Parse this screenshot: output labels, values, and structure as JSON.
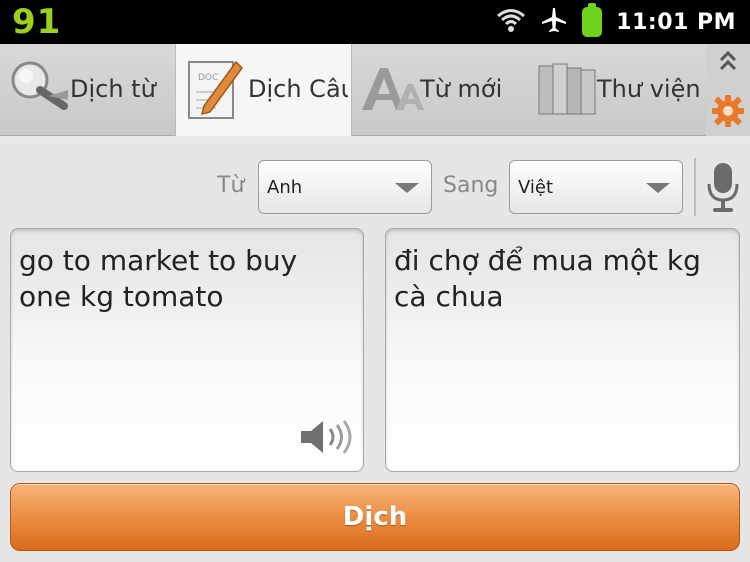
{
  "status_bar": {
    "notification_count": "91",
    "time": "11:01 PM",
    "icons": [
      "wifi-icon",
      "airplane-icon",
      "battery-icon"
    ]
  },
  "tabs": [
    {
      "label": "Dịch từ",
      "icon": "magnifier-icon",
      "active": false
    },
    {
      "label": "Dịch Câu",
      "icon": "document-pencil-icon",
      "active": true
    },
    {
      "label": "Từ mới",
      "icon": "font-aa-icon",
      "active": false
    },
    {
      "label": "Thư viện",
      "icon": "books-icon",
      "active": false
    }
  ],
  "side_controls": {
    "collapse_icon": "double-chevron-up-icon",
    "settings_icon": "gear-icon"
  },
  "language": {
    "from_label": "Từ",
    "from_value": "Anh",
    "to_label": "Sang",
    "to_value": "Việt",
    "mic_icon": "microphone-icon"
  },
  "source_text": "go to market to buy one kg tomato",
  "translated_text": "đi chợ để mua một kg cà chua",
  "speaker_icon": "speaker-icon",
  "translate_button": "Dịch",
  "colors": {
    "accent_orange": "#ea8a3e",
    "status_green": "#9ad21b",
    "status_bar_bg": "#000000"
  }
}
